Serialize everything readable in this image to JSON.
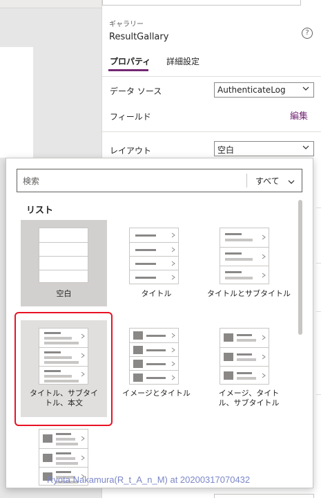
{
  "panel": {
    "control_type": "ギャラリー",
    "control_name": "ResultGallary",
    "help_icon": "?",
    "tabs": [
      {
        "label": "プロパティ",
        "active": true
      },
      {
        "label": "詳細設定",
        "active": false
      }
    ],
    "data_source": {
      "label": "データ ソース",
      "value": "AuthenticateLog"
    },
    "fields": {
      "label": "フィールド",
      "edit_label": "編集"
    },
    "layout": {
      "label": "レイアウト",
      "value": "空白"
    }
  },
  "layout_popup": {
    "search": {
      "placeholder": "検索",
      "value": ""
    },
    "filter": {
      "selected": "すべて"
    },
    "section_title": "リスト",
    "templates": [
      {
        "label": "空白",
        "state": "selected"
      },
      {
        "label": "タイトル",
        "state": "normal"
      },
      {
        "label": "タイトルとサブタイトル",
        "state": "normal"
      },
      {
        "label": "タイトル、サブタイトル、本文",
        "state": "highlighted"
      },
      {
        "label": "イメージとタイトル",
        "state": "normal"
      },
      {
        "label": "イメージ、タイトル、サブタイトル",
        "state": "normal"
      },
      {
        "label": "",
        "state": "normal"
      }
    ]
  },
  "watermark": "Ryota Nakamura(R_t_A_n_M) at 20200317070432",
  "colors": {
    "accent": "#742774",
    "highlight_border": "#e81123",
    "selected_tile": "#d2d0ce"
  }
}
